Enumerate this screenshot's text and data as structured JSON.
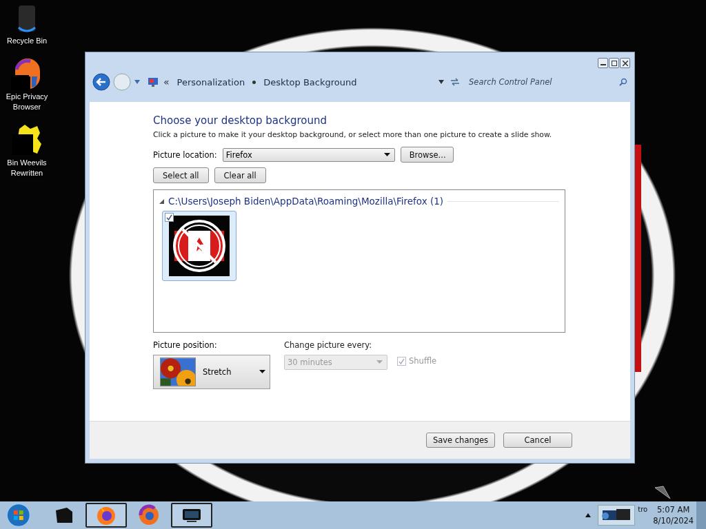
{
  "desktop": {
    "icons": [
      {
        "label": "Recycle Bin",
        "kind": "bin"
      },
      {
        "label": "Epic Privacy Browser",
        "kind": "browser"
      },
      {
        "label": "Bin Weevils Rewritten",
        "kind": "game"
      }
    ]
  },
  "window": {
    "chevron": "«",
    "breadcrumbs": [
      "Personalization",
      "Desktop Background"
    ],
    "search": {
      "placeholder": "Search Control Panel"
    },
    "heading": "Choose your desktop background",
    "description": "Click a picture to make it your desktop background, or select more than one picture to create a slide show.",
    "picture_location": {
      "label": "Picture location:",
      "value": "Firefox"
    },
    "browse_button": "Browse...",
    "select_all_button": "Select all",
    "clear_all_button": "Clear all",
    "group": {
      "header": "C:\\Users\\Joseph Biden\\AppData\\Roaming\\Mozilla\\Firefox (1)",
      "expanded": true,
      "pictures": [
        {
          "kind": "picture",
          "checked": true,
          "selected": true
        }
      ]
    },
    "picture_position": {
      "label": "Picture position:",
      "value": "Stretch"
    },
    "change_picture": {
      "label": "Change picture every:",
      "value": "30 minutes",
      "disabled": true
    },
    "shuffle": {
      "label": "Shuffle",
      "checked": true,
      "disabled": true
    },
    "footer_buttons": [
      "Save changes",
      "Cancel"
    ]
  },
  "taskbar": {
    "items": [
      {
        "kind": "terminal",
        "running": false
      },
      {
        "kind": "firefox",
        "running": true
      },
      {
        "kind": "browser",
        "running": false
      },
      {
        "kind": "monitor",
        "running": true
      }
    ],
    "tray_text": "tro",
    "time": "5:07 AM",
    "date": "8/10/2024"
  }
}
